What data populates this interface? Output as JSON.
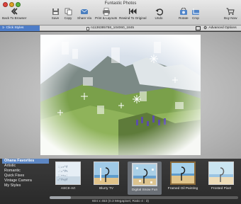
{
  "app": {
    "title": "Funtastic Photos"
  },
  "toolbar": {
    "back_label": "Back To Browser",
    "save_label": "Save",
    "copy_label": "Copy",
    "share_label": "Share Via",
    "print_label": "Print & Layouts",
    "rewind_label": "Rewind To Original",
    "undo_label": "Undo",
    "rotate_label": "Rotate",
    "crop_label": "Crop",
    "buy_label": "Buy Now"
  },
  "subbar": {
    "active_tab": "1- Click Styles",
    "filename": "n1136385758_104060_1845",
    "advanced_label": "Advanced Options"
  },
  "categories": [
    {
      "label": "Ohana Favorites",
      "selected": true
    },
    {
      "label": "Artistic",
      "selected": false
    },
    {
      "label": "Romantic",
      "selected": false
    },
    {
      "label": "Quick Fixes",
      "selected": false
    },
    {
      "label": "Vintage Camera",
      "selected": false
    },
    {
      "label": "My Styles",
      "selected": false
    }
  ],
  "styles": [
    {
      "label": "ASCII-Art",
      "selected": false
    },
    {
      "label": "Blurry TV",
      "selected": false
    },
    {
      "label": "Digital Snow Fun",
      "selected": true
    },
    {
      "label": "Framed Oil Painting",
      "selected": false
    },
    {
      "label": "Frosted Pixel",
      "selected": false
    }
  ],
  "status": {
    "info": "604 x 453 (0.3 Megapixel, Ratio 4 : 3)"
  },
  "colors": {
    "accent": "#5d87c4",
    "selection_tab": "#4d7cc7"
  }
}
